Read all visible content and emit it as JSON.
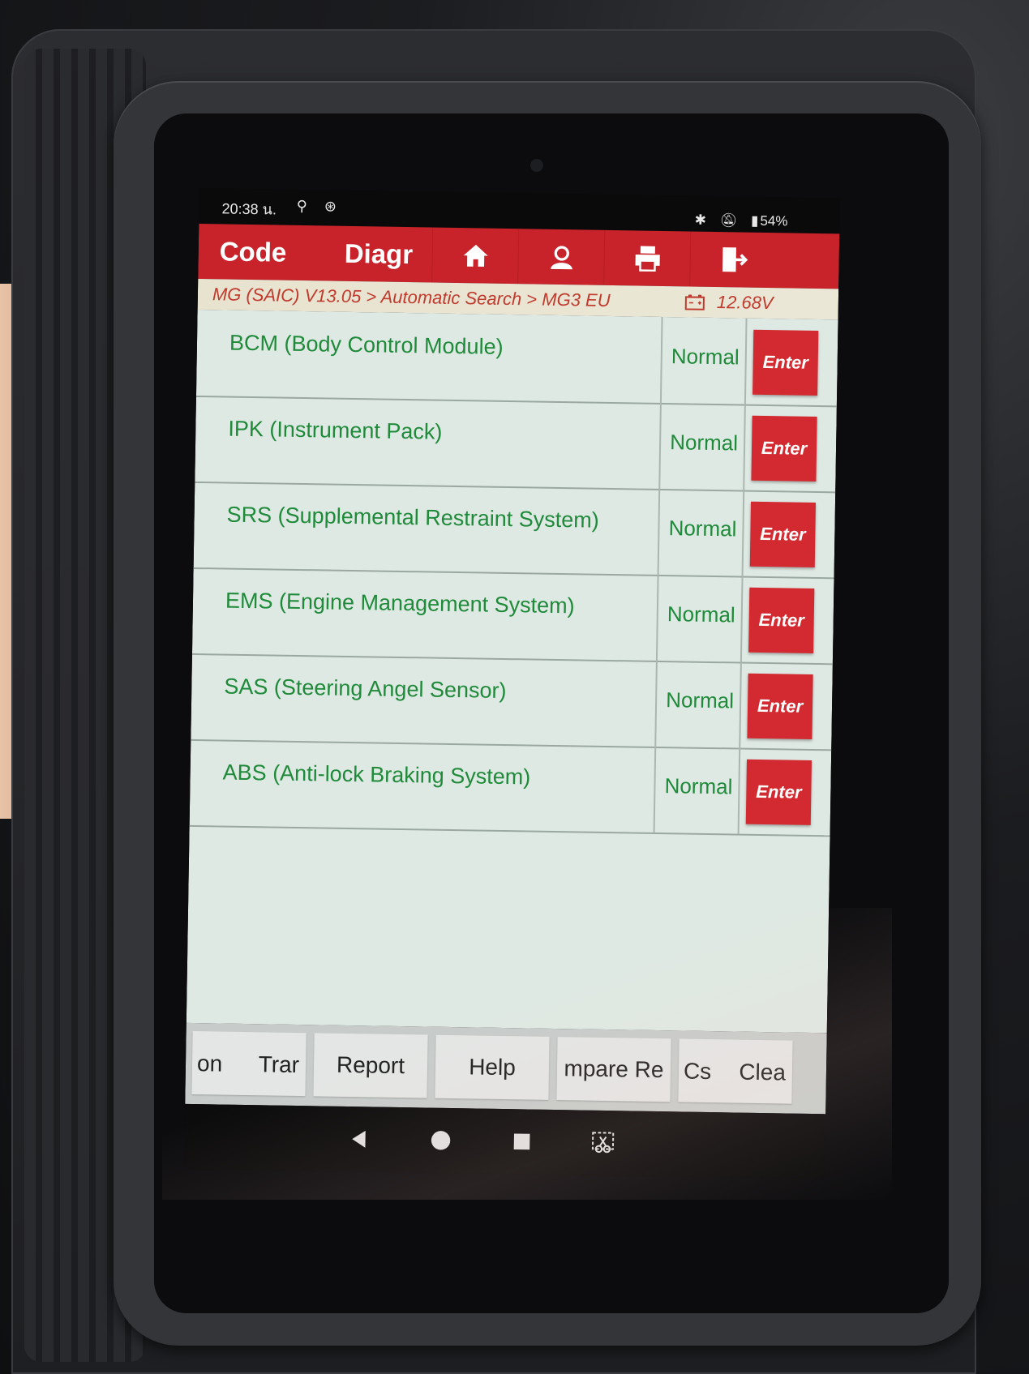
{
  "status_bar": {
    "time": "20:38 น.",
    "battery": "54%"
  },
  "header": {
    "tab_code": "Code",
    "tab_diag": "Diagr",
    "icons": [
      "home-icon",
      "user-icon",
      "print-icon",
      "exit-icon"
    ],
    "color": "#c8232a"
  },
  "breadcrumb": {
    "text": "MG (SAIC) V13.05 > Automatic Search > MG3 EU",
    "voltage": "12.68V"
  },
  "systems": [
    {
      "name": "BCM (Body Control Module)",
      "status": "Normal",
      "action": "Enter"
    },
    {
      "name": "IPK (Instrument Pack)",
      "status": "Normal",
      "action": "Enter"
    },
    {
      "name": "SRS (Supplemental Restraint System)",
      "status": "Normal",
      "action": "Enter"
    },
    {
      "name": "EMS (Engine Management System)",
      "status": "Normal",
      "action": "Enter"
    },
    {
      "name": "SAS (Steering Angel Sensor)",
      "status": "Normal",
      "action": "Enter"
    },
    {
      "name": "ABS (Anti-lock Braking System)",
      "status": "Normal",
      "action": "Enter"
    }
  ],
  "bottom_buttons": {
    "b1_left": "on",
    "b1_right": "Trar",
    "report": "Report",
    "help": "Help",
    "compare": "mpare Re",
    "b5_left": "Cs",
    "b5_right": "Clea"
  },
  "colors": {
    "accent": "#c8232a",
    "text_green": "#1f8a3a",
    "list_bg": "#dfe9e3"
  }
}
